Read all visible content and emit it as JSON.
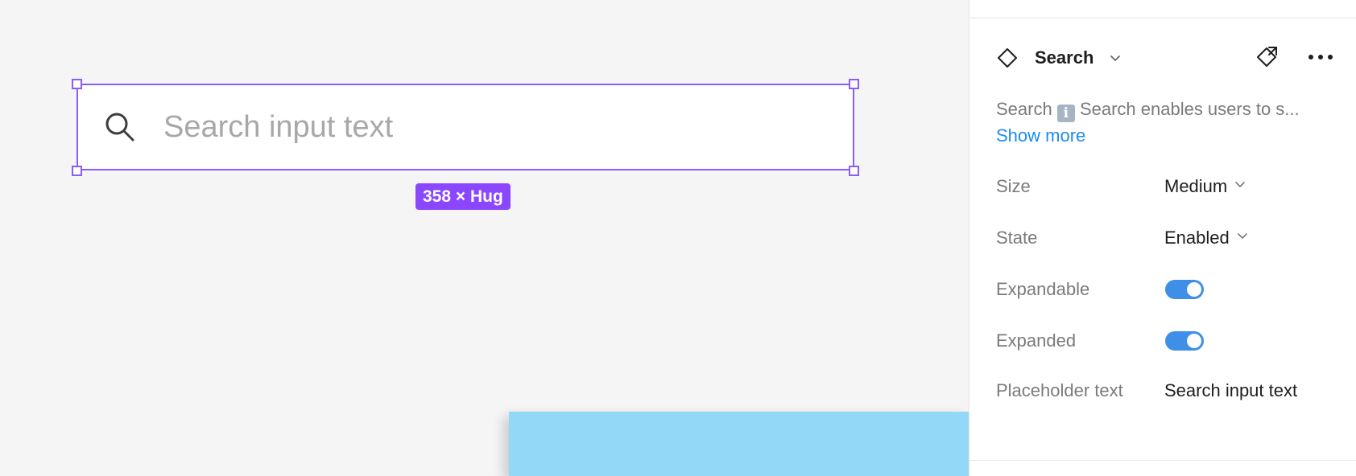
{
  "canvas": {
    "search": {
      "placeholder": "Search input text",
      "icon": "magnifier-icon"
    },
    "selection_badge": "358 × Hug",
    "colors": {
      "selection": "#8b5cf6",
      "badge": "#8b46ff",
      "blue_frame": "#94d8f8"
    }
  },
  "panel": {
    "component": {
      "icon": "component-instance-icon",
      "name": "Search",
      "chevron": "chevron-down-icon",
      "go_to_main_icon": "go-to-main-component-icon",
      "more_icon": "more-horizontal-icon"
    },
    "description": {
      "prefix": "Search ",
      "emoji": "i",
      "text": " Search enables users to s...",
      "show_more": "Show more"
    },
    "properties": {
      "size": {
        "label": "Size",
        "value": "Medium"
      },
      "state": {
        "label": "State",
        "value": "Enabled"
      },
      "expandable": {
        "label": "Expandable",
        "value": true
      },
      "expanded": {
        "label": "Expanded",
        "value": true
      },
      "placeholder": {
        "label": "Placeholder text",
        "value": "Search input text"
      }
    },
    "colors": {
      "toggle_on": "#3f8fe8",
      "link": "#1b8cf0"
    }
  }
}
